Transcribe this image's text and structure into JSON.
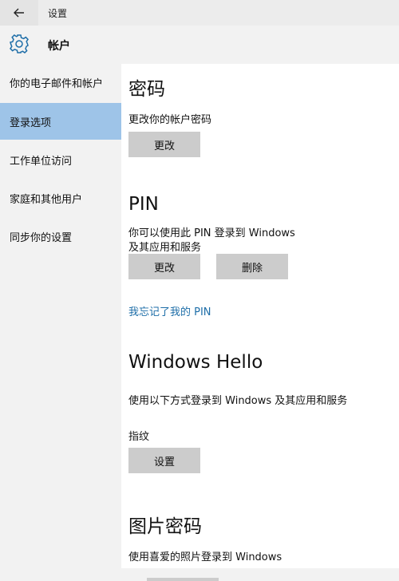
{
  "titlebar": {
    "title": "设置",
    "back_icon": "arrow-left-icon"
  },
  "header": {
    "title": "帐户",
    "icon": "gear-icon"
  },
  "sidebar": {
    "items": [
      {
        "label": "你的电子邮件和帐户"
      },
      {
        "label": "登录选项",
        "selected": true
      },
      {
        "label": "工作单位访问"
      },
      {
        "label": "家庭和其他用户"
      },
      {
        "label": "同步你的设置"
      }
    ]
  },
  "password": {
    "title": "密码",
    "description": "更改你的帐户密码",
    "change_label": "更改"
  },
  "pin": {
    "title": "PIN",
    "description_line1": "你可以使用此 PIN 登录到 Windows",
    "description_line2": "及其应用和服务",
    "change_label": "更改",
    "remove_label": "删除",
    "forgot_link": "我忘记了我的 PIN"
  },
  "hello": {
    "title": "Windows Hello",
    "description": "使用以下方式登录到 Windows 及其应用和服务",
    "fingerprint_label": "指纹",
    "setup_label": "设置"
  },
  "picture_password": {
    "title": "图片密码",
    "description": "使用喜爱的照片登录到 Windows"
  },
  "colors": {
    "accent": "#1e6ea8",
    "selected_bg": "#9ec4e8",
    "button_bg": "#cccccc",
    "content_bg": "#ffffff",
    "sidebar_bg": "#f2f2f2"
  }
}
